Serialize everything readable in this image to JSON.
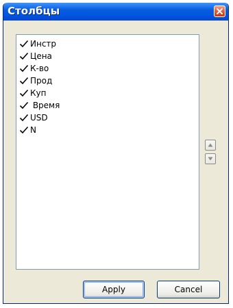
{
  "window": {
    "title": "Столбцы"
  },
  "columns": {
    "items": [
      {
        "label": "Инстр",
        "checked": true
      },
      {
        "label": "Цена",
        "checked": true
      },
      {
        "label": "К-во",
        "checked": true
      },
      {
        "label": "Прод",
        "checked": true
      },
      {
        "label": "Куп",
        "checked": true
      },
      {
        "label": " Время",
        "checked": true
      },
      {
        "label": "USD",
        "checked": true
      },
      {
        "label": "N",
        "checked": true
      }
    ]
  },
  "controls": {
    "up_icon": "arrow-up-icon",
    "down_icon": "arrow-down-icon"
  },
  "buttons": {
    "apply_label": "Apply",
    "cancel_label": "Cancel"
  },
  "colors": {
    "titlebar": "#0a5ddc",
    "dialog_bg": "#ece9d8",
    "close_button": "#e25a3a"
  }
}
